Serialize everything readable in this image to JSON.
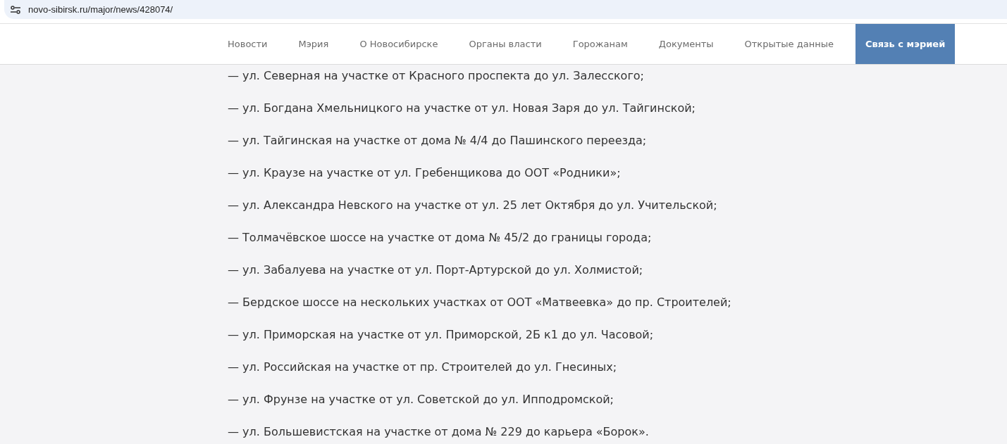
{
  "address_bar": {
    "url": "novo-sibirsk.ru/major/news/428074/"
  },
  "nav": [
    {
      "label": "Новости",
      "kind": "link"
    },
    {
      "label": "Мэрия",
      "kind": "link"
    },
    {
      "label": "О Новосибирске",
      "kind": "link"
    },
    {
      "label": "Органы власти",
      "kind": "link"
    },
    {
      "label": "Горожанам",
      "kind": "link"
    },
    {
      "label": "Документы",
      "kind": "link"
    },
    {
      "label": "Открытые данные",
      "kind": "link"
    },
    {
      "label": "Связь с мэрией",
      "kind": "cta"
    }
  ],
  "paragraphs": [
    "— ул. Северная на участке от Красного проспекта до ул. Залесского;",
    "— ул. Богдана Хмельницкого на участке от ул. Новая Заря до ул. Тайгинской;",
    "— ул. Тайгинская на участке от дома № 4/4 до Пашинского переезда;",
    "— ул. Краузе на участке от ул. Гребенщикова до ООТ «Родники»;",
    "— ул. Александра Невского на участке от ул. 25 лет Октября до ул. Учительской;",
    "— Толмачёвское шоссе на участке от дома № 45/2 до границы города;",
    "— ул. Забалуева на участке от ул. Порт-Артурской до ул. Холмистой;",
    "— Бердское шоссе на нескольких участках от ООТ «Матвеевка» до пр. Строителей;",
    "— ул. Приморская на участке от ул. Приморской, 2Б к1 до ул. Часовой;",
    "— ул. Российская на участке от пр. Строителей до ул. Гнесиных;",
    "— ул. Фрунзе на участке от ул. Советской до ул. Ипподромской;",
    "— ул. Большевистская на участке от дома № 229 до карьера «Борок»."
  ]
}
